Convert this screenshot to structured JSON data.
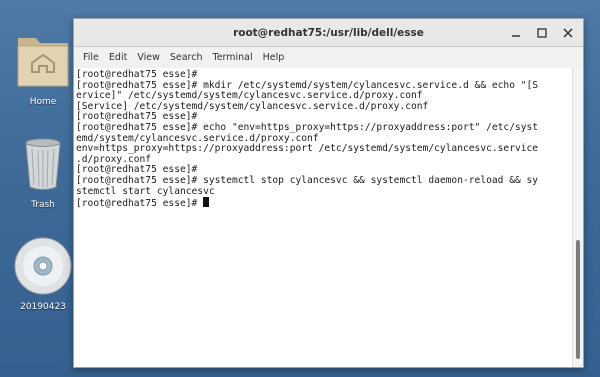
{
  "desktop": {
    "icons": [
      {
        "label": "Home"
      },
      {
        "label": "Trash"
      },
      {
        "label": "20190423"
      }
    ]
  },
  "window": {
    "title": "root@redhat75:/usr/lib/dell/esse",
    "menu": [
      "File",
      "Edit",
      "View",
      "Search",
      "Terminal",
      "Help"
    ],
    "terminal_lines": [
      "[root@redhat75 esse]#",
      "[root@redhat75 esse]# mkdir /etc/systemd/system/cylancesvc.service.d && echo \"[S",
      "ervice]\" /etc/systemd/system/cylancesvc.service.d/proxy.conf",
      "[Service] /etc/systemd/system/cylancesvc.service.d/proxy.conf",
      "[root@redhat75 esse]#",
      "[root@redhat75 esse]# echo \"env=https_proxy=https://proxyaddress:port\" /etc/syst",
      "emd/system/cylancesvc.service.d/proxy.conf",
      "env=https_proxy=https://proxyaddress:port /etc/systemd/system/cylancesvc.service",
      ".d/proxy.conf",
      "[root@redhat75 esse]#",
      "[root@redhat75 esse]# systemctl stop cylancesvc && systemctl daemon-reload && sy",
      "stemctl start cylancesvc"
    ],
    "prompt": "[root@redhat75 esse]# "
  },
  "colors": {
    "desktop": "#4a75a2",
    "terminal_bg": "#ffffff",
    "terminal_fg": "#1c1c1c"
  }
}
